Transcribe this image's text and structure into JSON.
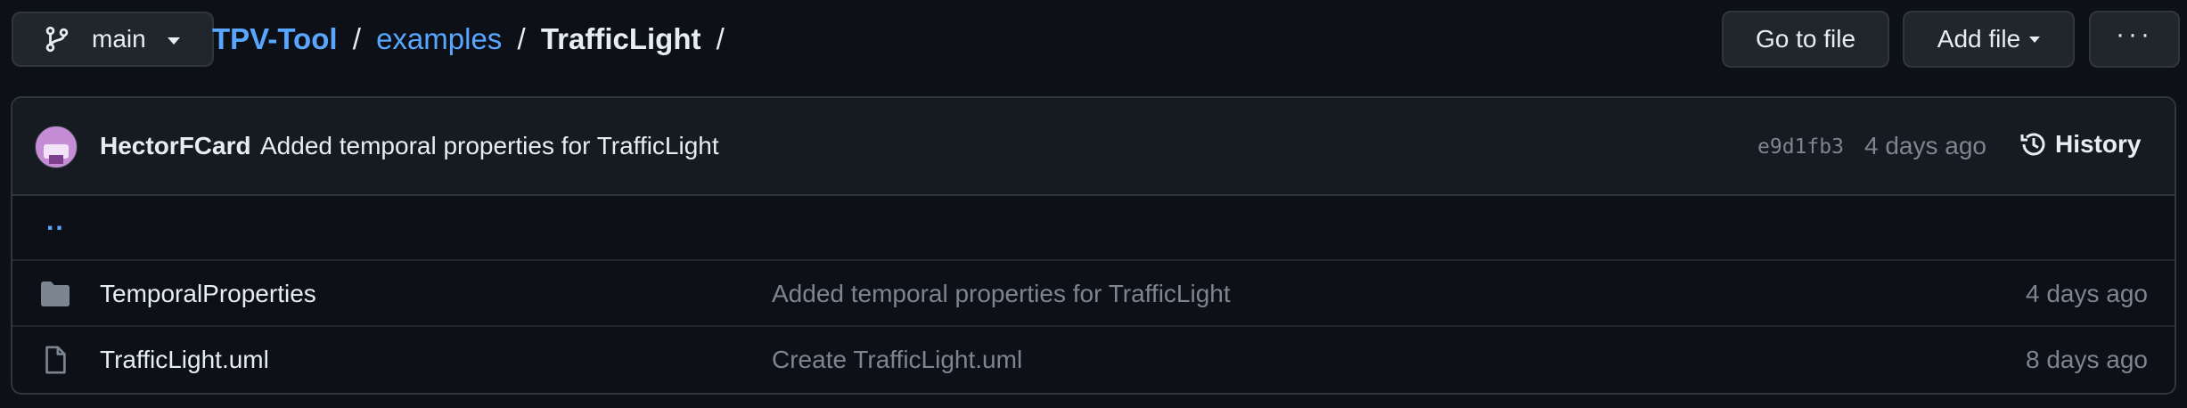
{
  "branch": {
    "name": "main"
  },
  "breadcrumb": {
    "repo": "TPV-Tool",
    "dir": "examples",
    "current": "TrafficLight",
    "sep": "/"
  },
  "actions": {
    "go_to_file": "Go to file",
    "add_file": "Add file",
    "more": "···"
  },
  "commit": {
    "author": "HectorFCard",
    "message": "Added temporal properties for TrafficLight",
    "sha": "e9d1fb3",
    "time": "4 days ago",
    "history_label": "History"
  },
  "files": {
    "parent": "..",
    "rows": [
      {
        "type": "folder",
        "icon": "folder-icon",
        "name": "TemporalProperties",
        "message": "Added temporal properties for TrafficLight",
        "time": "4 days ago"
      },
      {
        "type": "file",
        "icon": "file-icon",
        "name": "TrafficLight.uml",
        "message": "Create TrafficLight.uml",
        "time": "8 days ago"
      }
    ]
  },
  "colors": {
    "background": "#0d1117",
    "link": "#58a6ff",
    "muted": "#7d8590",
    "border": "#30363d",
    "folder": "#7d8590"
  }
}
